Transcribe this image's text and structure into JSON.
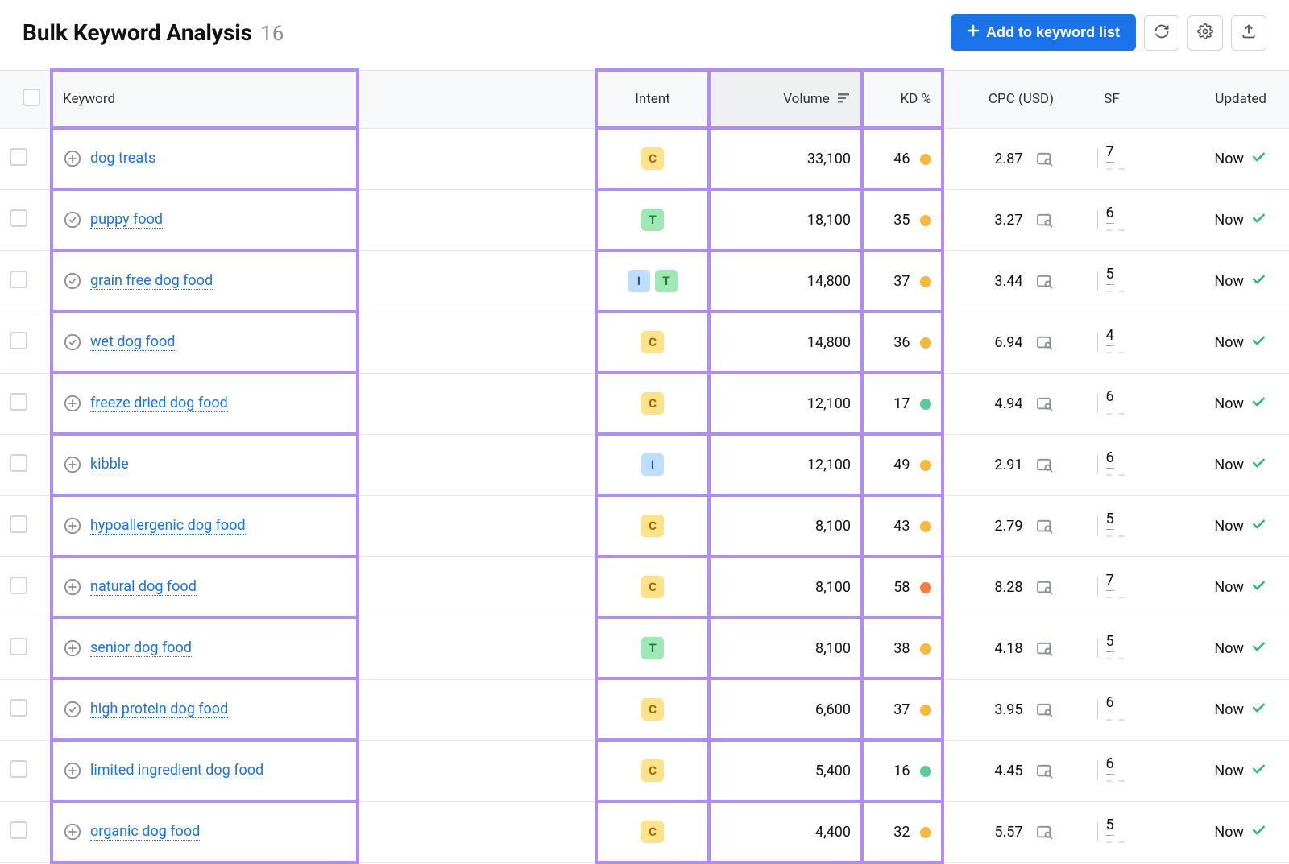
{
  "header": {
    "title": "Bulk Keyword Analysis",
    "count": "16",
    "add_button": "Add to keyword list"
  },
  "columns": {
    "keyword": "Keyword",
    "intent": "Intent",
    "volume": "Volume",
    "kd": "KD %",
    "cpc": "CPC (USD)",
    "sf": "SF",
    "updated": "Updated"
  },
  "rows": [
    {
      "icon": "plus",
      "keyword": "dog treats",
      "intents": [
        "C"
      ],
      "volume": "33,100",
      "kd": "46",
      "kd_color": "yellow",
      "cpc": "2.87",
      "sf": "7",
      "updated": "Now"
    },
    {
      "icon": "check",
      "keyword": "puppy food",
      "intents": [
        "T"
      ],
      "volume": "18,100",
      "kd": "35",
      "kd_color": "yellow",
      "cpc": "3.27",
      "sf": "6",
      "updated": "Now"
    },
    {
      "icon": "check",
      "keyword": "grain free dog food",
      "intents": [
        "I",
        "T"
      ],
      "volume": "14,800",
      "kd": "37",
      "kd_color": "yellow",
      "cpc": "3.44",
      "sf": "5",
      "updated": "Now"
    },
    {
      "icon": "check",
      "keyword": "wet dog food",
      "intents": [
        "C"
      ],
      "volume": "14,800",
      "kd": "36",
      "kd_color": "yellow",
      "cpc": "6.94",
      "sf": "4",
      "updated": "Now"
    },
    {
      "icon": "plus",
      "keyword": "freeze dried dog food",
      "intents": [
        "C"
      ],
      "volume": "12,100",
      "kd": "17",
      "kd_color": "green",
      "cpc": "4.94",
      "sf": "6",
      "updated": "Now"
    },
    {
      "icon": "plus",
      "keyword": "kibble",
      "intents": [
        "I"
      ],
      "volume": "12,100",
      "kd": "49",
      "kd_color": "yellow",
      "cpc": "2.91",
      "sf": "6",
      "updated": "Now"
    },
    {
      "icon": "plus",
      "keyword": "hypoallergenic dog food",
      "intents": [
        "C"
      ],
      "volume": "8,100",
      "kd": "43",
      "kd_color": "yellow",
      "cpc": "2.79",
      "sf": "5",
      "updated": "Now"
    },
    {
      "icon": "plus",
      "keyword": "natural dog food",
      "intents": [
        "C"
      ],
      "volume": "8,100",
      "kd": "58",
      "kd_color": "orange",
      "cpc": "8.28",
      "sf": "7",
      "updated": "Now"
    },
    {
      "icon": "plus",
      "keyword": "senior dog food",
      "intents": [
        "T"
      ],
      "volume": "8,100",
      "kd": "38",
      "kd_color": "yellow",
      "cpc": "4.18",
      "sf": "5",
      "updated": "Now"
    },
    {
      "icon": "check",
      "keyword": "high protein dog food",
      "intents": [
        "C"
      ],
      "volume": "6,600",
      "kd": "37",
      "kd_color": "yellow",
      "cpc": "3.95",
      "sf": "6",
      "updated": "Now"
    },
    {
      "icon": "plus",
      "keyword": "limited ingredient dog food",
      "intents": [
        "C"
      ],
      "volume": "5,400",
      "kd": "16",
      "kd_color": "green",
      "cpc": "4.45",
      "sf": "6",
      "updated": "Now"
    },
    {
      "icon": "plus",
      "keyword": "organic dog food",
      "intents": [
        "C"
      ],
      "volume": "4,400",
      "kd": "32",
      "kd_color": "yellow",
      "cpc": "5.57",
      "sf": "5",
      "updated": "Now"
    }
  ]
}
